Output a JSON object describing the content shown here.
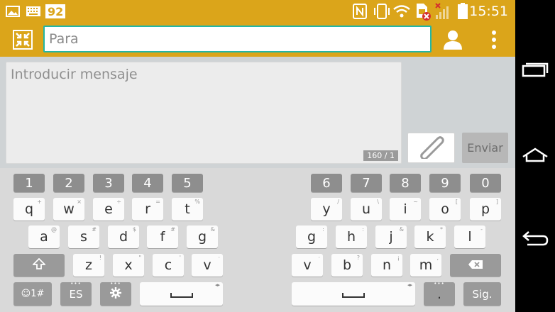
{
  "status_bar": {
    "battery_level_text": "92",
    "time": "15:51",
    "icons": [
      "image-icon",
      "keyboard-icon",
      "nfc-icon",
      "vibrate-icon",
      "wifi-icon",
      "sim-error-icon",
      "signal-icon",
      "battery-icon"
    ]
  },
  "action_bar": {
    "to_placeholder": "Para",
    "to_value": "",
    "left_icon": "collapse-icon",
    "contact_icon": "person-icon",
    "menu_icon": "overflow-menu-icon"
  },
  "compose": {
    "message_placeholder": "Introducir mensaje",
    "message_value": "",
    "char_counter": "160 / 1",
    "send_label": "Enviar",
    "attach_icon": "paperclip-icon"
  },
  "keyboard": {
    "numbers_left": [
      "1",
      "2",
      "3",
      "4",
      "5"
    ],
    "numbers_right": [
      "6",
      "7",
      "8",
      "9",
      "0"
    ],
    "row1_left": [
      "q",
      "w",
      "e",
      "r",
      "t"
    ],
    "row1_right": [
      "y",
      "u",
      "i",
      "o",
      "p"
    ],
    "row2_left": [
      "a",
      "s",
      "d",
      "f",
      "g"
    ],
    "row2_right": [
      "g",
      "h",
      "j",
      "k",
      "l"
    ],
    "row3_left": [
      "z",
      "x",
      "c",
      "v"
    ],
    "row3_right": [
      "v",
      "b",
      "n",
      "m"
    ],
    "symbols_label": "☺1#",
    "language_label": "ES",
    "period_label": ".",
    "next_label": "Sig.",
    "hints_row1_left": [
      "+",
      "×",
      "÷",
      "=",
      "%"
    ],
    "hints_row1_right": [
      "/",
      "\\",
      "~",
      "[",
      "]"
    ],
    "hints_row2_left": [
      "@",
      "#",
      "$",
      "#",
      "&"
    ],
    "hints_row2_right": [
      ":",
      ":",
      "&",
      "*",
      "-"
    ],
    "hints_row3_left": [
      "!",
      "\"",
      "'",
      "·"
    ],
    "hints_row3_right": [
      "·",
      "?",
      "¡",
      ","
    ]
  },
  "nav_bar": {
    "icons": [
      "recent-apps-icon",
      "home-icon",
      "back-icon"
    ]
  }
}
